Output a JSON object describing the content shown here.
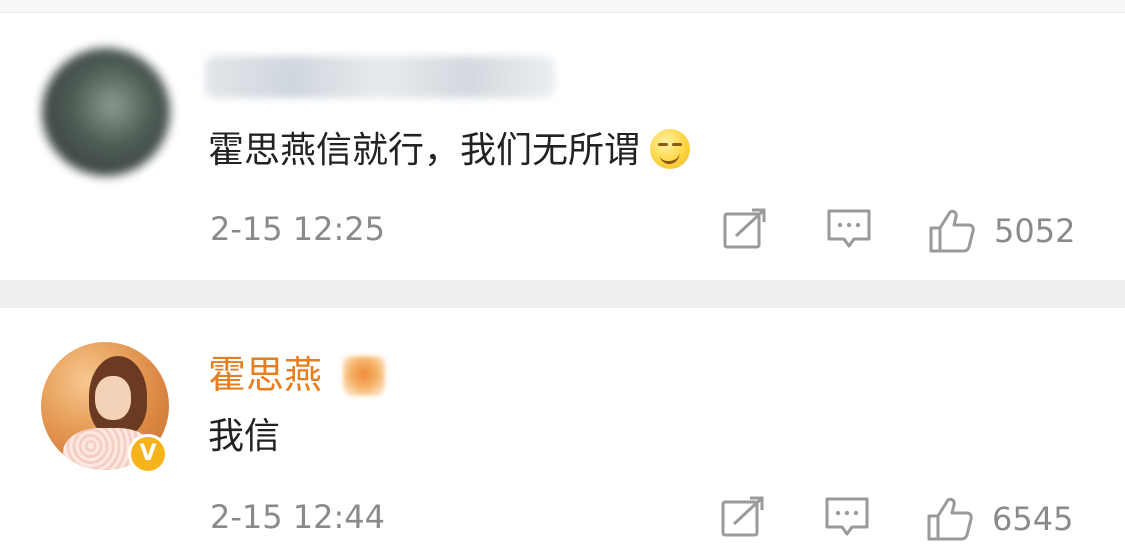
{
  "comments": [
    {
      "username": "",
      "text": "霍思燕信就行，我们无所谓",
      "emoji": "smirk-emoji",
      "timestamp": "2-15 12:25",
      "likes": "5052",
      "avatar": "blurred-avatar"
    },
    {
      "username": "霍思燕",
      "text": "我信",
      "timestamp": "2-15 12:44",
      "likes": "6545",
      "verified_badge": "V",
      "accent_color": "#e67e22",
      "avatar": "user-photo-avatar"
    }
  ],
  "icons": {
    "share": "share-icon",
    "reply": "comment-icon",
    "like": "thumbs-up-icon"
  },
  "colors": {
    "username": "#e67e22",
    "text": "#222222",
    "meta": "#8a8a8a",
    "separator": "#efefef",
    "verified": "#f6b31b"
  }
}
